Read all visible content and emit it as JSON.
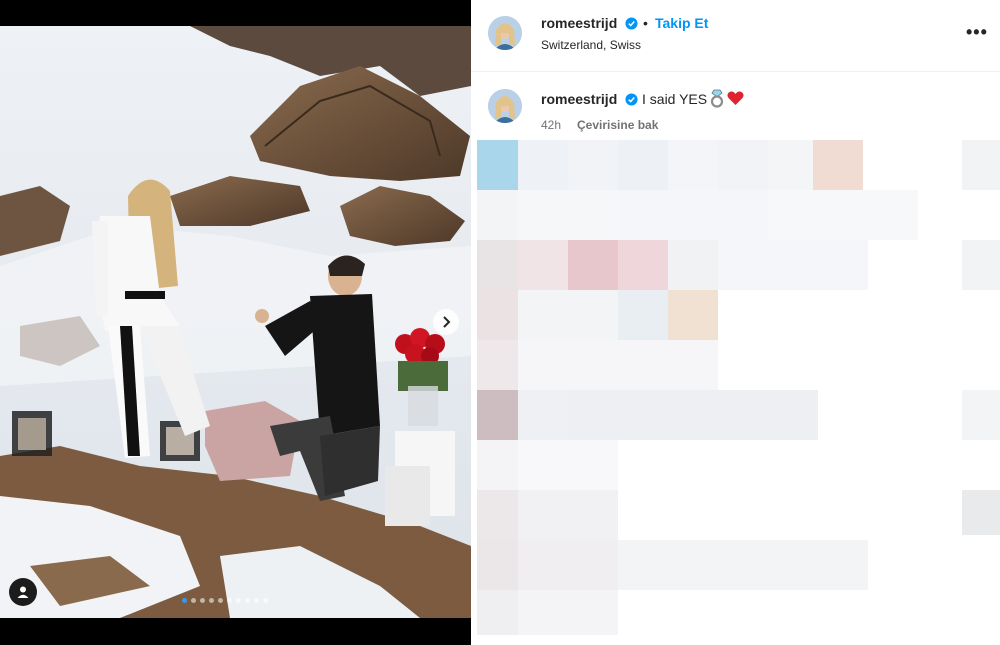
{
  "post": {
    "username": "romeestrijd",
    "follow_label": "Takip Et",
    "separator": "•",
    "location": "Switzerland, Swiss",
    "more_label": "•••"
  },
  "caption": {
    "username": "romeestrijd",
    "text": "I said YES",
    "emojis": [
      "ring-emoji",
      "heart-emoji"
    ],
    "time": "42h",
    "translate_label": "Çevirisine bak"
  },
  "colors": {
    "accent": "#0095f6",
    "verified": "#0095f6",
    "active_dot": "#3797f0",
    "heart": "#e0242f"
  },
  "carousel": {
    "slide_count": 10,
    "active_index": 0
  },
  "icons": [
    "user-tag-icon",
    "chevron-right-icon",
    "verified-badge-icon",
    "more-options-icon",
    "ring-emoji",
    "heart-emoji"
  ]
}
